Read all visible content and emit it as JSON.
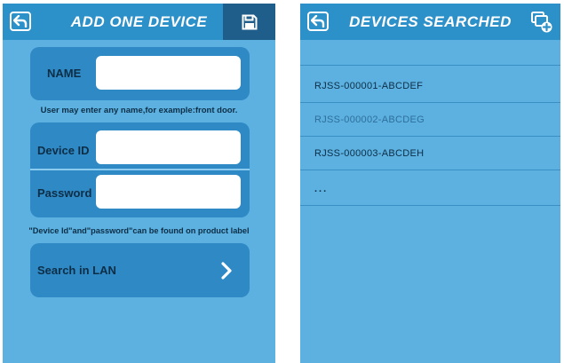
{
  "left_screen": {
    "title": "ADD ONE DEVICE",
    "name_label": "NAME",
    "name_value": "",
    "name_hint": "User may enter any name,for example:front door.",
    "device_id_label": "Device  ID",
    "device_id_value": "",
    "password_label": "Password",
    "password_value": "",
    "credentials_hint": "\"Device Id\"and\"password\"can be found on product label",
    "search_label": "Search in LAN"
  },
  "right_screen": {
    "title": "DEVICES SEARCHED",
    "devices": [
      "RJSS-000001-ABCDEF",
      "RJSS-000002-ABCDEG",
      "RJSS-000003-ABCDEH",
      "..."
    ]
  },
  "colors": {
    "background": "#5cb1e0",
    "titlebar": "#2c90c9",
    "card": "#2f89c5",
    "save_button": "#1f5e8a",
    "text_dark": "#0d2e46"
  },
  "icons": {
    "back": "back-arrow-icon",
    "save": "floppy-disk-icon",
    "add": "add-device-icon",
    "chevron": "chevron-right-icon"
  }
}
